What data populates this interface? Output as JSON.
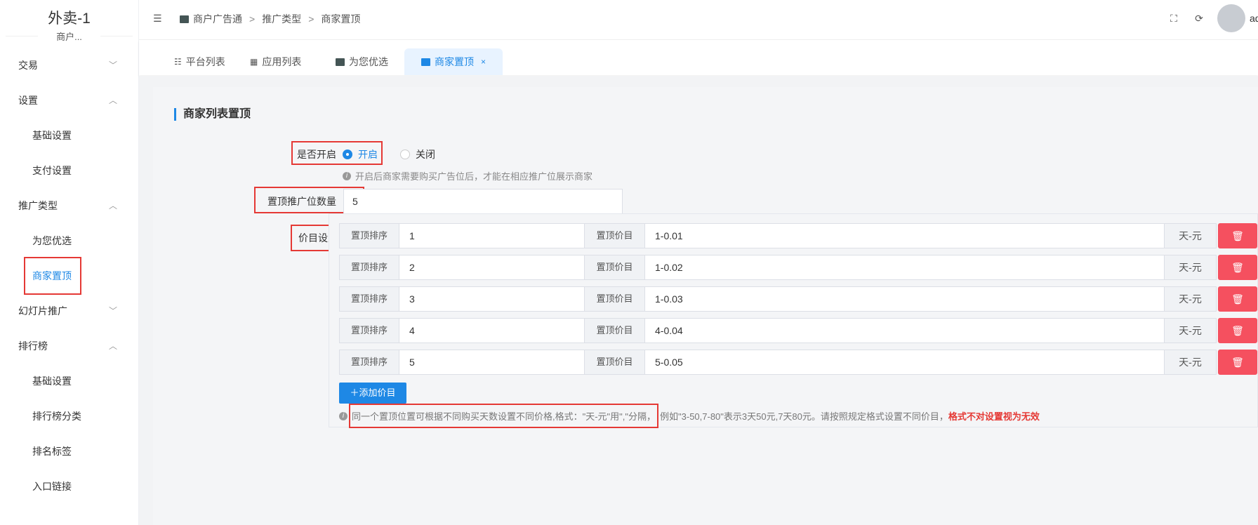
{
  "brand": {
    "title": "外卖-1",
    "subtitle": "商户..."
  },
  "sidebar": {
    "items": [
      {
        "label": "交易",
        "arrow": "﹀"
      },
      {
        "label": "设置",
        "arrow": "︿"
      },
      {
        "label": "基础设置"
      },
      {
        "label": "支付设置"
      },
      {
        "label": "推广类型",
        "arrow": "︿"
      },
      {
        "label": "为您优选"
      },
      {
        "label": "商家置顶"
      },
      {
        "label": "幻灯片推广",
        "arrow": "﹀"
      },
      {
        "label": "排行榜",
        "arrow": "︿"
      },
      {
        "label": "基础设置"
      },
      {
        "label": "排行榜分类"
      },
      {
        "label": "排名标签"
      },
      {
        "label": "入口链接"
      }
    ]
  },
  "header": {
    "breadcrumb": [
      "商户广告通",
      "推广类型",
      "商家置顶"
    ],
    "separator": ">",
    "user": "admin"
  },
  "tabs": [
    {
      "label": "平台列表"
    },
    {
      "label": "应用列表"
    },
    {
      "label": "为您优选"
    },
    {
      "label": "商家置顶",
      "close": "×"
    }
  ],
  "form": {
    "section_title": "商家列表置顶",
    "enable_label": "是否开启",
    "option_on": "开启",
    "option_off": "关闭",
    "enable_hint": "开启后商家需要购买广告位后，才能在相应推广位展示商家",
    "count_label": "置顶推广位数量",
    "count_value": "5",
    "price_label": "价目设置",
    "row_sort_label": "置顶排序",
    "row_price_label": "置顶价目",
    "row_suffix": "天-元",
    "rows": [
      {
        "sort": "1",
        "price": "1-0.01"
      },
      {
        "sort": "2",
        "price": "1-0.02"
      },
      {
        "sort": "3",
        "price": "1-0.03"
      },
      {
        "sort": "4",
        "price": "4-0.04"
      },
      {
        "sort": "5",
        "price": "5-0.05"
      }
    ],
    "add_button": "＋添加价目",
    "note_part1": "同一个置顶位置可根据不同购买天数设置不同价格,格式：\"天-元\"用\",\"分隔，",
    "note_part2": "例如\"3-50,7-80\"表示3天50元,7天80元。请按照规定格式设置不同价目，",
    "note_warn": "格式不对设置视为无效"
  },
  "colors": {
    "accent": "#1e88e5",
    "danger": "#f5505f",
    "highlight": "#e53935"
  }
}
